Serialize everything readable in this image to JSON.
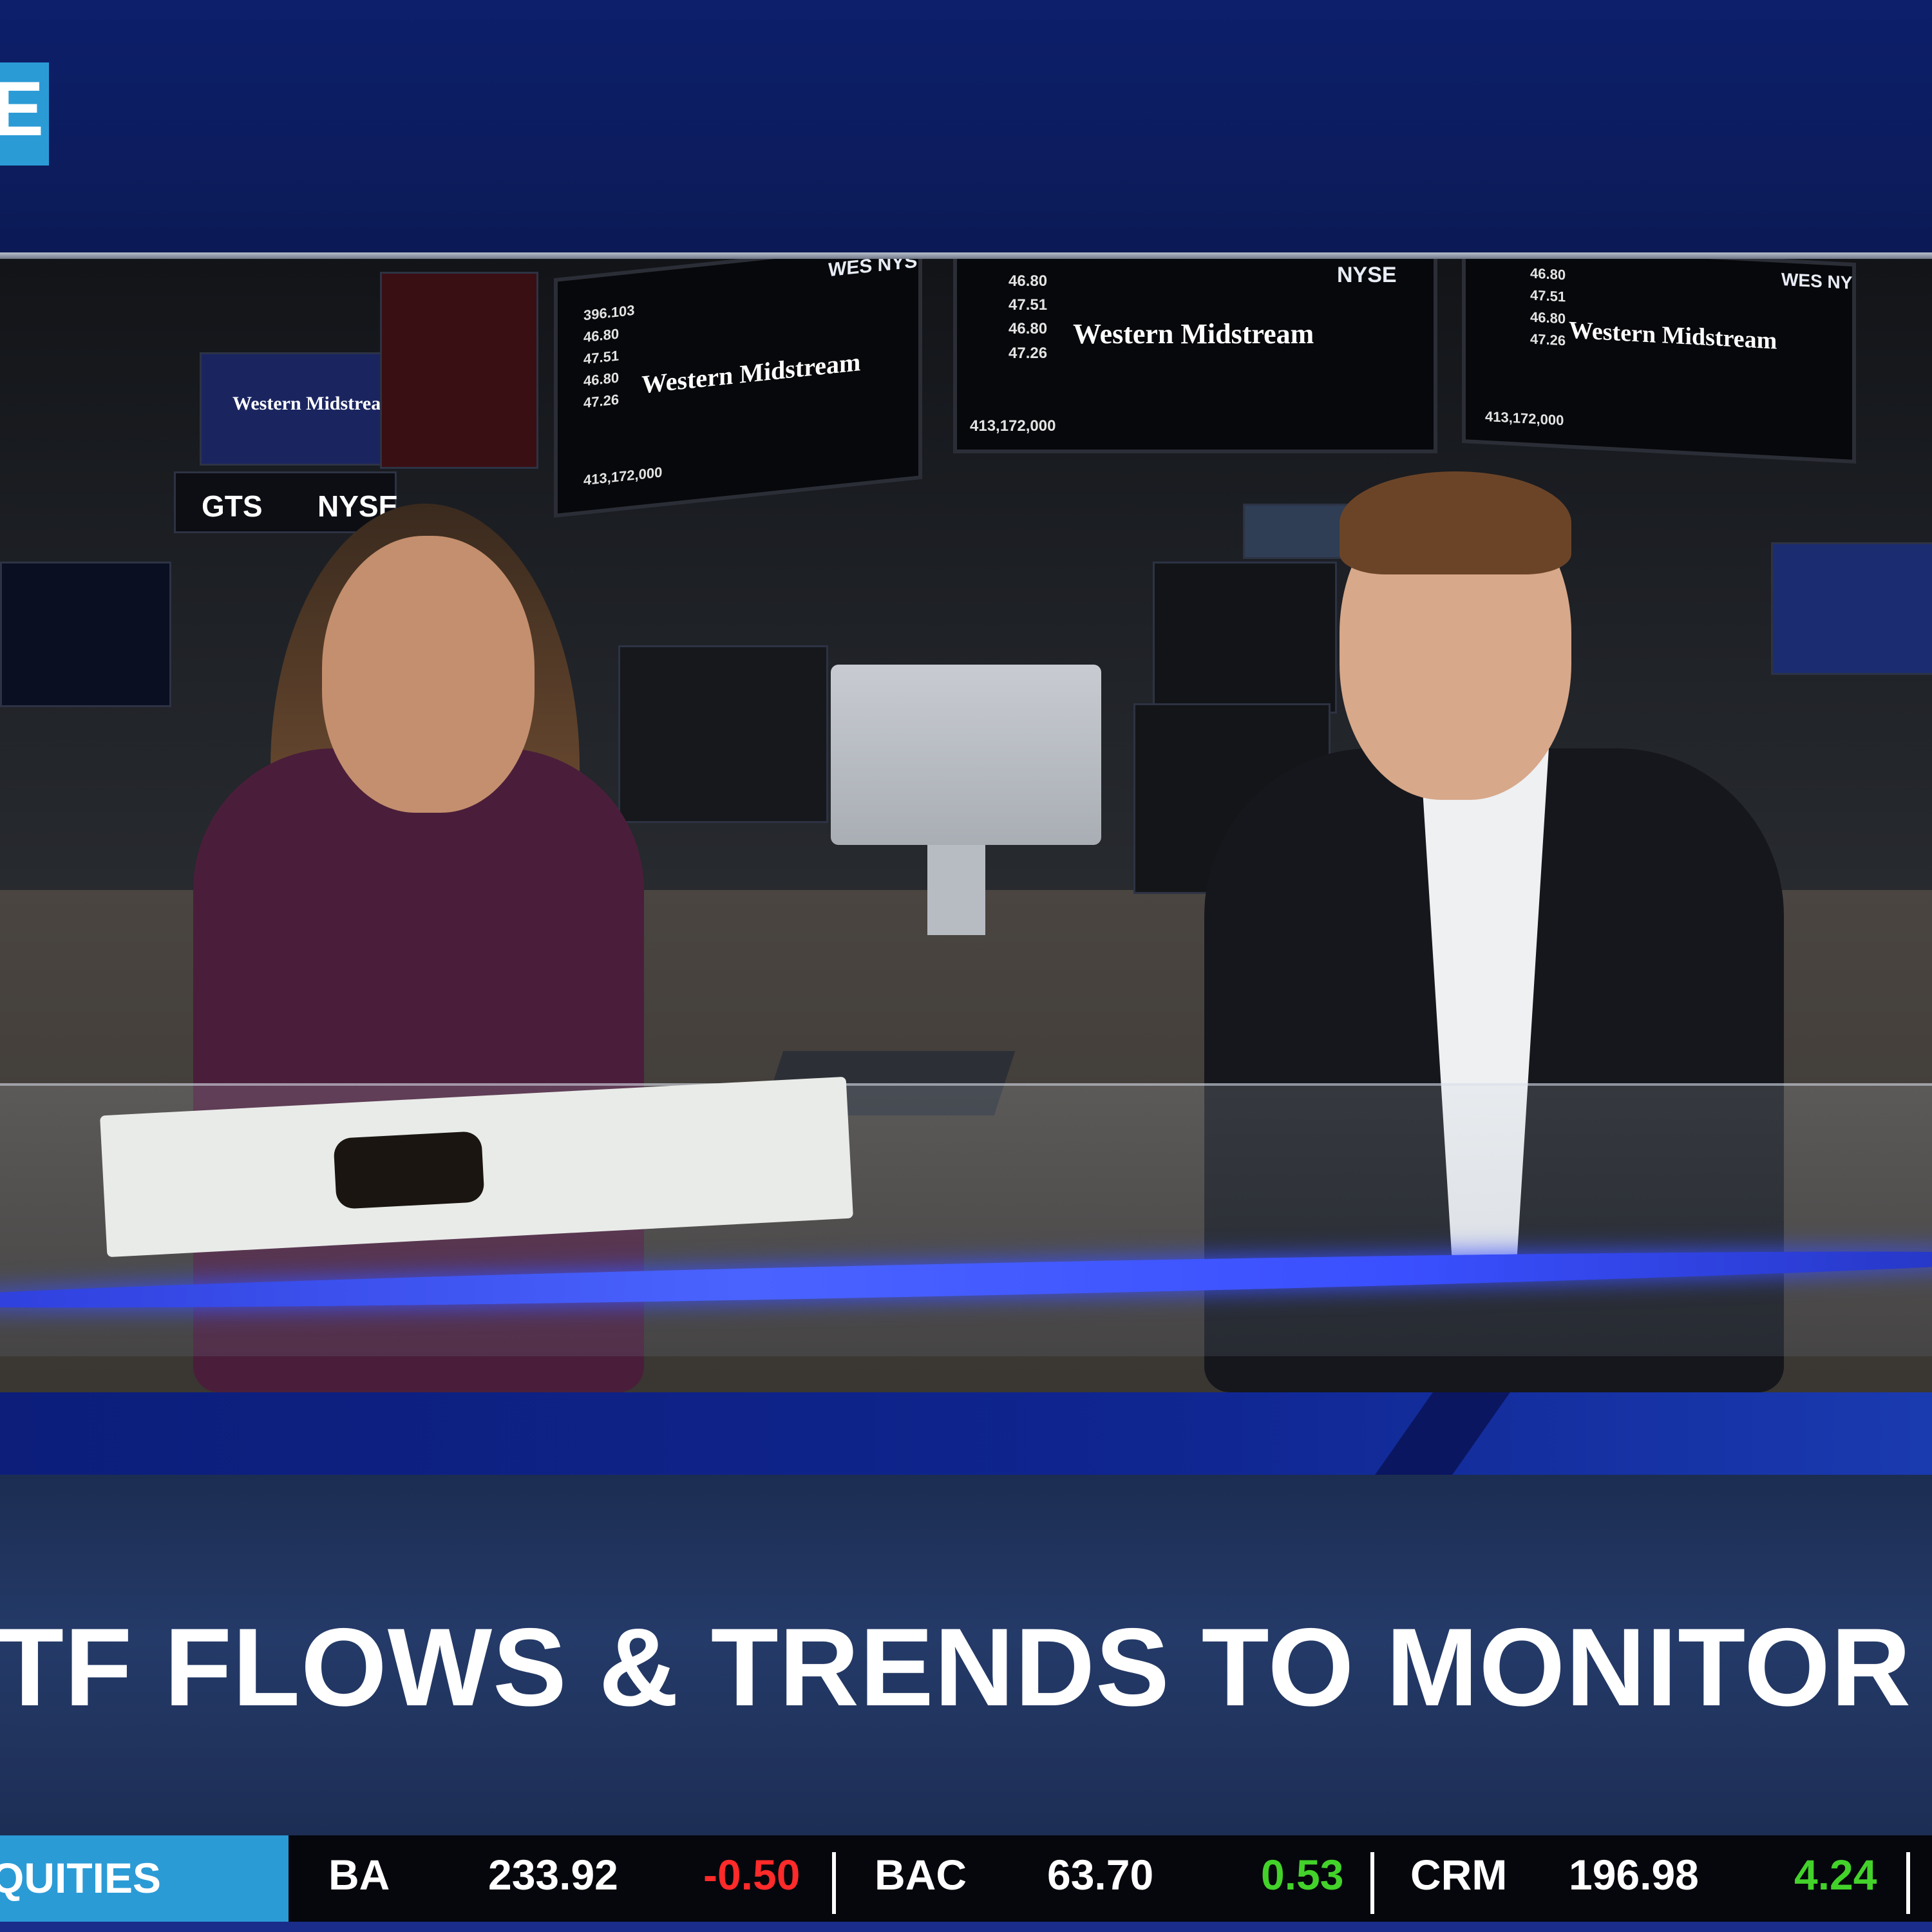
{
  "broadcast": {
    "logo_letter": "E",
    "headline": "TF FLOWS & TRENDS TO MONITOR"
  },
  "studio": {
    "monitors": [
      {
        "brand": "Western Midstream",
        "nyse": "WES NYSE",
        "prices": [
          "396.103",
          "46.80",
          "47.51",
          "46.80",
          "47.26"
        ],
        "volume": "413,172,000"
      },
      {
        "brand": "Western Midstream",
        "nyse": "NYSE",
        "prices": [
          "46.80",
          "47.51",
          "46.80",
          "47.26"
        ],
        "volume": "413,172,000"
      },
      {
        "brand": "Western Midstream",
        "nyse": "WES NYSE",
        "prices": [
          "46.80",
          "47.51",
          "46.80",
          "47.26"
        ],
        "volume": "413,172,000"
      }
    ],
    "left_sign": "Western Midstream",
    "gts_sign": "GTS",
    "nyse_sign": "NYSE"
  },
  "ticker": {
    "category_label": "QUITIES",
    "items": [
      {
        "symbol": "BA",
        "price": "233.92",
        "change": "-0.50",
        "direction": "down"
      },
      {
        "symbol": "BAC",
        "price": "63.70",
        "change": "0.53",
        "direction": "up"
      },
      {
        "symbol": "CRM",
        "price": "196.98",
        "change": "4.24",
        "direction": "up"
      }
    ]
  },
  "colors": {
    "accent": "#2b9bd6",
    "navy": "#0d1f6b",
    "negative": "#ff2a2a",
    "positive": "#43d22a"
  }
}
